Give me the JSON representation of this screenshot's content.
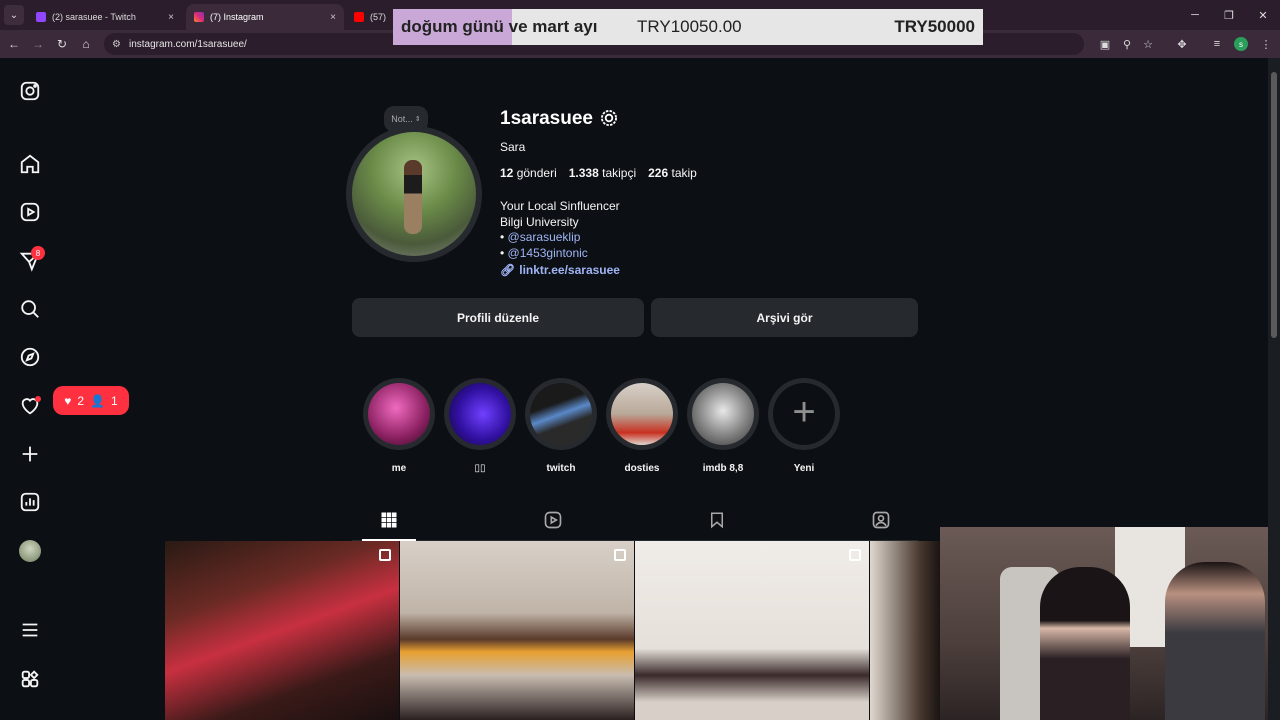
{
  "browser": {
    "tabs": [
      {
        "title": "(2) sarasuee - Twitch",
        "favicon_color": "#9146ff",
        "active": false
      },
      {
        "title": "(7) Instagram",
        "favicon_color": "#e1306c",
        "active": true
      },
      {
        "title": "(57) 2Pa",
        "favicon_color": "#ff0000",
        "active": false
      }
    ],
    "tab_close": "×",
    "url": "instagram.com/1sarasuee/",
    "profile_initial": "s",
    "window_controls": [
      "─",
      "❐",
      "✕"
    ]
  },
  "overlay": {
    "goal_label": "doğum günü ve mart ayı",
    "current": "TRY10050.00",
    "target": "TRY50000",
    "progress_fraction": 0.201,
    "fill_color": "#c9a8d8"
  },
  "sidebar": {
    "notification_count": "8",
    "activity": {
      "likes": "2",
      "followers": "1"
    }
  },
  "profile": {
    "note_label": "Not...",
    "username": "1sarasuee",
    "full_name": "Sara",
    "stats": [
      {
        "count": "12",
        "label": "gönderi"
      },
      {
        "count": "1.338",
        "label": "takipçi"
      },
      {
        "count": "226",
        "label": "takip"
      }
    ],
    "bio_lines": [
      "Your Local Sinfluencer",
      "Bilgi University"
    ],
    "mentions": [
      "@sarasueklip",
      "@1453gintonic"
    ],
    "bullet": "•",
    "link": "linktr.ee/sarasuee",
    "edit_button": "Profili düzenle",
    "archive_button": "Arşivi gör"
  },
  "highlights": [
    {
      "label": "me"
    },
    {
      "label": "▯▯"
    },
    {
      "label": "twitch"
    },
    {
      "label": "dosties"
    },
    {
      "label": "imdb 8,8"
    },
    {
      "label": "Yeni"
    }
  ],
  "new_highlight_symbol": "+",
  "colors": {
    "background": "#0c1014",
    "button": "#262a2f",
    "link": "#a0b4f5",
    "badge": "#ff3040"
  }
}
